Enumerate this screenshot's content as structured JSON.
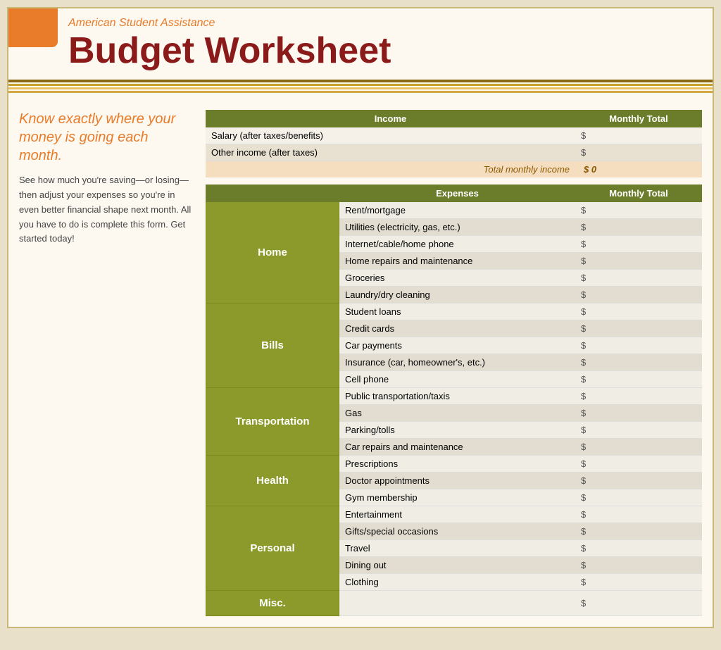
{
  "header": {
    "subtitle": "American Student Assistance",
    "title": "Budget Worksheet"
  },
  "left": {
    "tagline": "Know exactly where your money is going each month.",
    "description": "See how much you're saving—or losing—then adjust your expenses so you're in even better financial shape next month. All you have to do is complete this form. Get started today!"
  },
  "income": {
    "section_header": "Income",
    "monthly_total_header": "Monthly Total",
    "rows": [
      {
        "label": "Salary (after taxes/benefits)",
        "value": "$"
      },
      {
        "label": "Other income (after taxes)",
        "value": "$"
      }
    ],
    "total_label": "Total monthly income",
    "total_value": "$ 0"
  },
  "expenses": {
    "section_header": "Expenses",
    "monthly_total_header": "Monthly Total",
    "categories": [
      {
        "name": "Home",
        "rows": [
          {
            "label": "Rent/mortgage",
            "value": "$"
          },
          {
            "label": "Utilities (electricity, gas, etc.)",
            "value": "$"
          },
          {
            "label": "Internet/cable/home phone",
            "value": "$"
          },
          {
            "label": "Home repairs and maintenance",
            "value": "$"
          },
          {
            "label": "Groceries",
            "value": "$"
          },
          {
            "label": "Laundry/dry cleaning",
            "value": "$"
          }
        ]
      },
      {
        "name": "Bills",
        "rows": [
          {
            "label": "Student loans",
            "value": "$"
          },
          {
            "label": "Credit cards",
            "value": "$"
          },
          {
            "label": "Car payments",
            "value": "$"
          },
          {
            "label": "Insurance (car, homeowner's, etc.)",
            "value": "$"
          },
          {
            "label": "Cell phone",
            "value": "$"
          }
        ]
      },
      {
        "name": "Transportation",
        "rows": [
          {
            "label": "Public transportation/taxis",
            "value": "$"
          },
          {
            "label": "Gas",
            "value": "$"
          },
          {
            "label": "Parking/tolls",
            "value": "$"
          },
          {
            "label": "Car repairs and maintenance",
            "value": "$"
          }
        ]
      },
      {
        "name": "Health",
        "rows": [
          {
            "label": "Prescriptions",
            "value": "$"
          },
          {
            "label": "Doctor appointments",
            "value": "$"
          },
          {
            "label": "Gym membership",
            "value": "$"
          }
        ]
      },
      {
        "name": "Personal",
        "rows": [
          {
            "label": "Entertainment",
            "value": "$"
          },
          {
            "label": "Gifts/special occasions",
            "value": "$"
          },
          {
            "label": "Travel",
            "value": "$"
          },
          {
            "label": "Dining out",
            "value": "$"
          },
          {
            "label": "Clothing",
            "value": "$"
          }
        ]
      },
      {
        "name": "Misc.",
        "rows": []
      }
    ]
  }
}
